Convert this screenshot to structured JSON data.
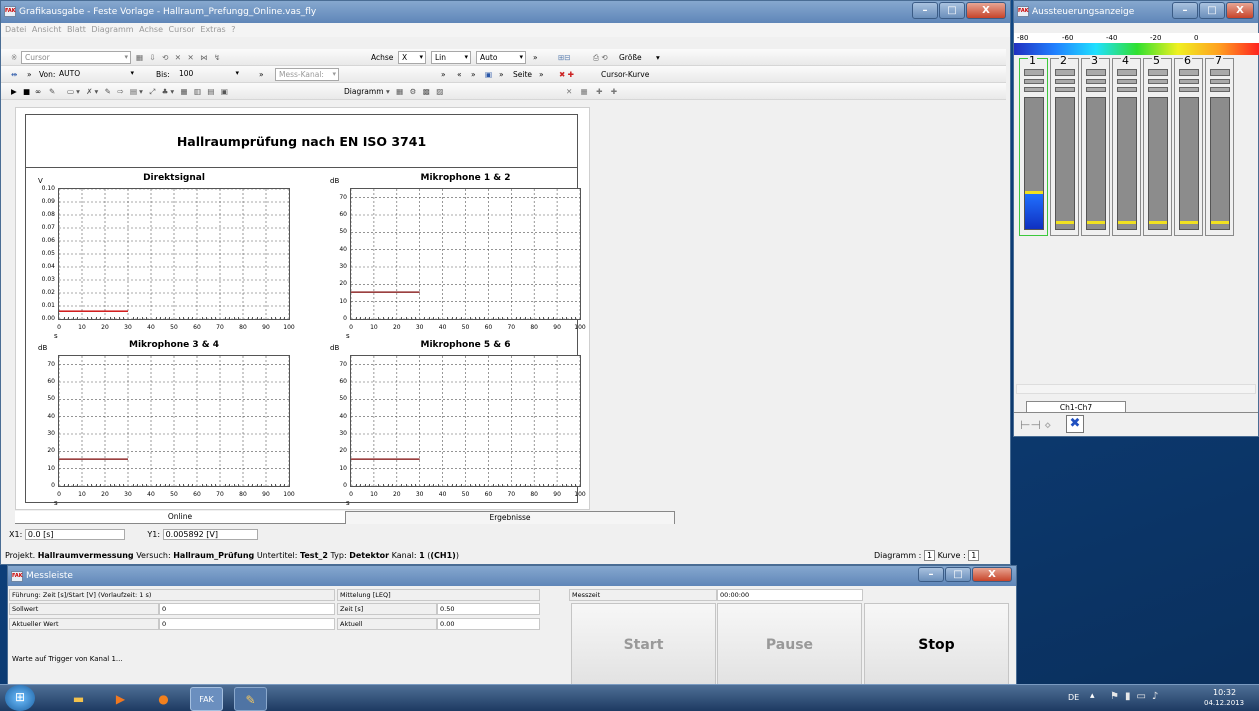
{
  "main_window": {
    "title": "Grafikausgabe - Feste Vorlage - Hallraum_Prefungg_Online.vas_fly",
    "menu": [
      "Datei",
      "Ansicht",
      "Blatt",
      "Diagramm",
      "Achse",
      "Cursor",
      "Extras",
      "?"
    ],
    "toolbar1": {
      "cursor_combo": "Cursor",
      "achse_label": "Achse",
      "achse_value": "X",
      "scale_value": "Lin",
      "range_value": "Auto",
      "groesse_label": "Größe"
    },
    "toolbar2": {
      "von_label": "Von:",
      "von_value": "AUTO",
      "bis_label": "Bis:",
      "bis_value": "100",
      "messkanal": "Mess-Kanal:",
      "seite_label": "Seite",
      "cursor_kurve": "Cursor-Kurve"
    },
    "toolbar3": {
      "diagramm_label": "Diagramm"
    },
    "page_title": "Hallraumprüfung nach EN ISO 3741",
    "tabs": [
      "Online",
      "Ergebnisse"
    ],
    "x1_label": "X1:",
    "x1_value": "0.0 [s]",
    "y1_label": "Y1:",
    "y1_value": "0.005892 [V]",
    "status": {
      "projekt_label": "Projekt.",
      "projekt": "Hallraumvermessung",
      "versuch_label": "Versuch:",
      "versuch": "Hallraum_Prüfung",
      "untertitel_label": "Untertitel:",
      "untertitel": "Test_2",
      "typ_label": "Typ:",
      "typ": "Detektor",
      "kanal_label": "Kanal:",
      "kanal": "1",
      "kanal_ch": "(CH1)",
      "diagramm_label": "Diagramm :",
      "diagramm_value": "1",
      "kurve_label": "Kurve :",
      "kurve_value": "1"
    }
  },
  "chart_data": [
    {
      "type": "line",
      "title": "Direktsignal",
      "ylabel": "V",
      "xlabel": "s",
      "xlim": [
        0,
        100
      ],
      "ylim": [
        0,
        0.1
      ],
      "xticks": [
        "0",
        "10",
        "20",
        "30",
        "40",
        "50",
        "60",
        "70",
        "80",
        "90",
        "100"
      ],
      "yticks": [
        "0.00",
        "0.01",
        "0.02",
        "0.03",
        "0.04",
        "0.05",
        "0.06",
        "0.07",
        "0.08",
        "0.09",
        "0.10"
      ],
      "series": [
        {
          "color": "#cc0000",
          "x": [
            0,
            30
          ],
          "y": [
            0.006,
            0.006
          ]
        }
      ]
    },
    {
      "type": "line",
      "title": "Mikrophone 1 & 2",
      "ylabel": "dB",
      "xlabel": "s",
      "xlim": [
        0,
        100
      ],
      "ylim": [
        0,
        75
      ],
      "xticks": [
        "0",
        "10",
        "20",
        "30",
        "40",
        "50",
        "60",
        "70",
        "80",
        "90",
        "100"
      ],
      "yticks": [
        "0",
        "10",
        "20",
        "30",
        "40",
        "50",
        "60",
        "70"
      ],
      "series": [
        {
          "color": "#7a0000",
          "x": [
            0,
            30
          ],
          "y": [
            15.5,
            15.5
          ]
        }
      ]
    },
    {
      "type": "line",
      "title": "Mikrophone 3 & 4",
      "ylabel": "dB",
      "xlabel": "s",
      "xlim": [
        0,
        100
      ],
      "ylim": [
        0,
        75
      ],
      "xticks": [
        "0",
        "10",
        "20",
        "30",
        "40",
        "50",
        "60",
        "70",
        "80",
        "90",
        "100"
      ],
      "yticks": [
        "0",
        "10",
        "20",
        "30",
        "40",
        "50",
        "60",
        "70"
      ],
      "series": [
        {
          "color": "#7a0000",
          "x": [
            0,
            30
          ],
          "y": [
            15.5,
            15.5
          ]
        }
      ]
    },
    {
      "type": "line",
      "title": "Mikrophone 5 & 6",
      "ylabel": "dB",
      "xlabel": "s",
      "xlim": [
        0,
        100
      ],
      "ylim": [
        0,
        75
      ],
      "xticks": [
        "0",
        "10",
        "20",
        "30",
        "40",
        "50",
        "60",
        "70",
        "80",
        "90",
        "100"
      ],
      "yticks": [
        "0",
        "10",
        "20",
        "30",
        "40",
        "50",
        "60",
        "70"
      ],
      "series": [
        {
          "color": "#7a0000",
          "x": [
            0,
            30
          ],
          "y": [
            15.5,
            15.5
          ]
        }
      ]
    }
  ],
  "mess": {
    "title": "Messleiste",
    "fuehrung": "Führung: Zeit [s]/Start [V]  (Vorlaufzeit: 1 s)",
    "sollwert_label": "Sollwert",
    "sollwert": "0",
    "aktuell_label": "Aktueller Wert",
    "aktuell": "0",
    "mittelung": "Mittelung [LEQ]",
    "zeit_label": "Zeit [s]",
    "zeit": "0.50",
    "aktuell2_label": "Aktuell",
    "aktuell2": "0.00",
    "messzeit_label": "Messzeit",
    "messzeit": "00:00:00",
    "warte": "Warte auf Trigger von Kanal 1...",
    "start": "Start",
    "pause": "Pause",
    "stop": "Stop"
  },
  "meter_window": {
    "title": "Aussteuerungsanzeige",
    "scale": [
      "-80",
      "-60",
      "-40",
      "-20",
      "0"
    ],
    "channels": [
      "1",
      "2",
      "3",
      "4",
      "5",
      "6",
      "7"
    ],
    "levels": [
      0.27,
      0,
      0,
      0,
      0,
      0,
      0
    ],
    "tab": "Ch1-Ch7"
  },
  "taskbar": {
    "lang": "DE",
    "time": "10:32",
    "date": "04.12.2013"
  }
}
